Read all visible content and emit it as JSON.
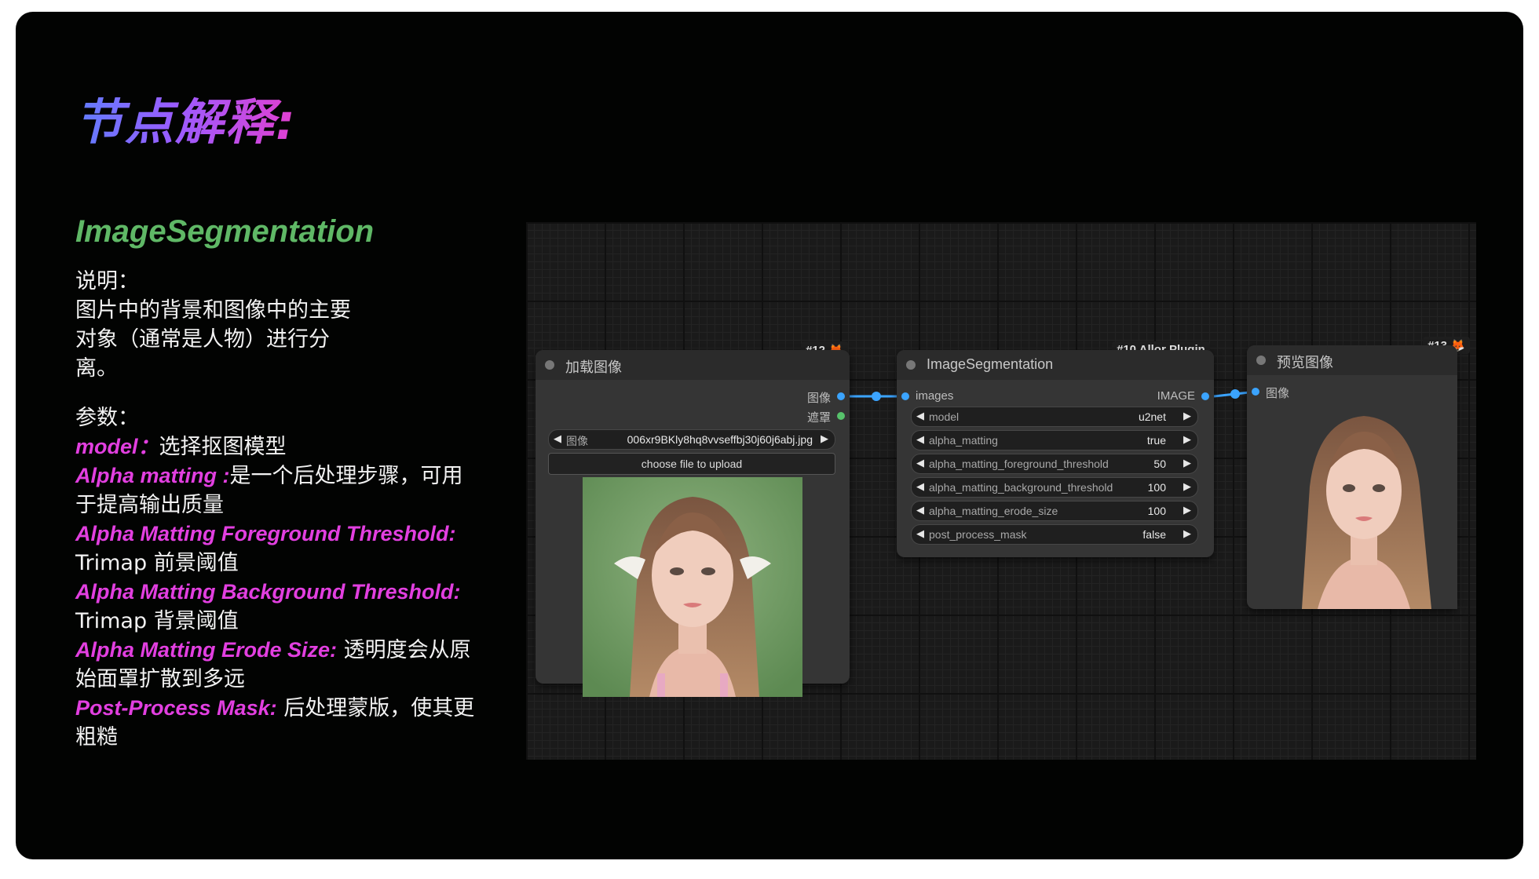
{
  "slide": {
    "title": "节点解释:",
    "node_heading": "ImageSegmentation",
    "desc_label": "说明：",
    "desc_text": "图片中的背景和图像中的主要对象（通常是人物）进行分离。",
    "params_label": "参数：",
    "params": [
      {
        "key": "model：",
        "text": "选择抠图模型"
      },
      {
        "key": "Alpha matting :",
        "text": "是一个后处理步骤，可用于提高输出质量"
      },
      {
        "key": "Alpha Matting Foreground Threshold:",
        "text": " Trimap 前景阈值"
      },
      {
        "key": "Alpha Matting Background Threshold:",
        "text": " Trimap 背景阈值"
      },
      {
        "key": "Alpha Matting Erode Size:",
        "text": " 透明度会从原始面罩扩散到多远"
      },
      {
        "key": "Post-Process Mask:",
        "text": " 后处理蒙版，使其更粗糙"
      }
    ]
  },
  "colors": {
    "title_start": "#5f7dff",
    "title_end": "#e23fd0",
    "heading": "#5fb866",
    "keyword": "#e23fe0",
    "link": "#3ba4ff"
  },
  "load_node": {
    "badge": "#12 🦊",
    "title": "加载图像",
    "out_image": "图像",
    "out_mask": "遮罩",
    "image_widget_label": "图像",
    "image_file": "006xr9BKly8hq8vvseffbj30j60j6abj.jpg",
    "upload_button": "choose file to upload"
  },
  "seg_node": {
    "badge": "#10 Allor Plugin",
    "title": "ImageSegmentation",
    "input": "images",
    "output": "IMAGE",
    "widgets": [
      {
        "label": "model",
        "value": "u2net"
      },
      {
        "label": "alpha_matting",
        "value": "true"
      },
      {
        "label": "alpha_matting_foreground_threshold",
        "value": "50"
      },
      {
        "label": "alpha_matting_background_threshold",
        "value": "100"
      },
      {
        "label": "alpha_matting_erode_size",
        "value": "100"
      },
      {
        "label": "post_process_mask",
        "value": "false"
      }
    ]
  },
  "preview_node": {
    "badge": "#13 🦊",
    "title": "预览图像",
    "input": "图像"
  }
}
